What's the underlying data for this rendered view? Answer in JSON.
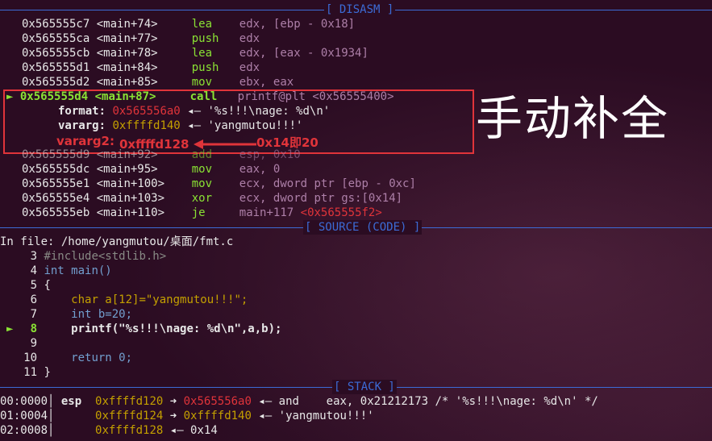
{
  "headers": {
    "disasm": "[ DISASM ]",
    "source": "[ SOURCE (CODE) ]",
    "stack": "[ STACK ]"
  },
  "disasm": [
    {
      "addr": "0x565555c7",
      "sym": "<main+74>",
      "mn": "lea",
      "ops": "edx, [ebp - 0x18]"
    },
    {
      "addr": "0x565555ca",
      "sym": "<main+77>",
      "mn": "push",
      "ops": "edx"
    },
    {
      "addr": "0x565555cb",
      "sym": "<main+78>",
      "mn": "lea",
      "ops": "edx, [eax - 0x1934]"
    },
    {
      "addr": "0x565555d1",
      "sym": "<main+84>",
      "mn": "push",
      "ops": "edx"
    },
    {
      "addr": "0x565555d2",
      "sym": "<main+85>",
      "mn": "mov",
      "ops": "ebx, eax"
    }
  ],
  "current": {
    "marker": "►",
    "addr": "0x565555d4",
    "sym": "<main+87>",
    "mn": "call",
    "ops": "printf@plt",
    "target": "<0x56555400>"
  },
  "args": {
    "format_label": "format:",
    "format_val": "0x565556a0",
    "format_str": "◂— '%s!!!\\nage: %d\\n'",
    "vararg_label": "vararg:",
    "vararg_val": "0xffffd140",
    "vararg_str": "◂— 'yangmutou!!!'"
  },
  "annotations": {
    "vararg2_label": "vararg2:",
    "vararg2_val": "0xffffd128",
    "offset_note": "0x14即20",
    "big_text": "手动补全"
  },
  "disasm_after": [
    {
      "addr": "0x565555d9",
      "sym": "<main+92>",
      "mn": "add",
      "ops": "esp, 0x10"
    },
    {
      "addr": "0x565555dc",
      "sym": "<main+95>",
      "mn": "mov",
      "ops": "eax, 0"
    },
    {
      "addr": "0x565555e1",
      "sym": "<main+100>",
      "mn": "mov",
      "ops": "ecx, dword ptr [ebp - 0xc]"
    },
    {
      "addr": "0x565555e4",
      "sym": "<main+103>",
      "mn": "xor",
      "ops": "ecx, dword ptr gs:[0x14]"
    },
    {
      "addr": "0x565555eb",
      "sym": "<main+110>",
      "mn": "je",
      "ops": "main+117",
      "target": "<0x565555f2>"
    }
  ],
  "source": {
    "file_label": "In file: /home/yangmutou/桌面/fmt.c",
    "lines": [
      {
        "n": "3",
        "marker": "",
        "code": "#include<stdlib.h>"
      },
      {
        "n": "4",
        "marker": "",
        "code": "int main()"
      },
      {
        "n": "5",
        "marker": "",
        "code": "{"
      },
      {
        "n": "6",
        "marker": "",
        "code": "    char a[12]=\"yangmutou!!!\";"
      },
      {
        "n": "7",
        "marker": "",
        "code": "    int b=20;"
      },
      {
        "n": "8",
        "marker": "►",
        "code": "    printf(\"%s!!!\\nage: %d\\n\",a,b);"
      },
      {
        "n": "9",
        "marker": "",
        "code": ""
      },
      {
        "n": "10",
        "marker": "",
        "code": "    return 0;"
      },
      {
        "n": "11",
        "marker": "",
        "code": "}"
      }
    ]
  },
  "stack": [
    {
      "idx": "00:0000",
      "reg": "esp",
      "addr": "0xffffd120",
      "p1": "0x565556a0",
      "rest": "◂— and    eax, 0x21212173 /* '%s!!!\\nage: %d\\n' */"
    },
    {
      "idx": "01:0004",
      "reg": "",
      "addr": "0xffffd124",
      "p1": "0xffffd140",
      "rest": "◂— 'yangmutou!!!'"
    },
    {
      "idx": "02:0008",
      "reg": "",
      "addr": "0xffffd128",
      "p1": "",
      "rest": "◂— 0x14"
    }
  ]
}
